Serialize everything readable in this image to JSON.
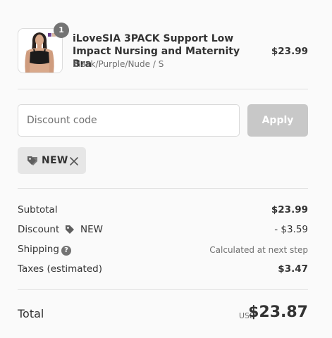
{
  "product": {
    "name": "iLoveSIA 3PACK Support Low Impact Nursing and Maternity Bra",
    "variant": "Black/Purple/Nude / S",
    "price": "$23.99",
    "quantity": "1"
  },
  "discount": {
    "placeholder": "Discount code",
    "apply_label": "Apply",
    "applied_code": "NEW"
  },
  "summary": {
    "subtotal_label": "Subtotal",
    "subtotal_value": "$23.99",
    "discount_label": "Discount",
    "discount_code": "NEW",
    "discount_value": "- $3.59",
    "shipping_label": "Shipping",
    "shipping_value": "Calculated at next step",
    "taxes_label": "Taxes (estimated)",
    "taxes_value": "$3.47"
  },
  "total": {
    "label": "Total",
    "currency": "USD",
    "value": "$23.87"
  },
  "icons": {
    "help": "?"
  }
}
